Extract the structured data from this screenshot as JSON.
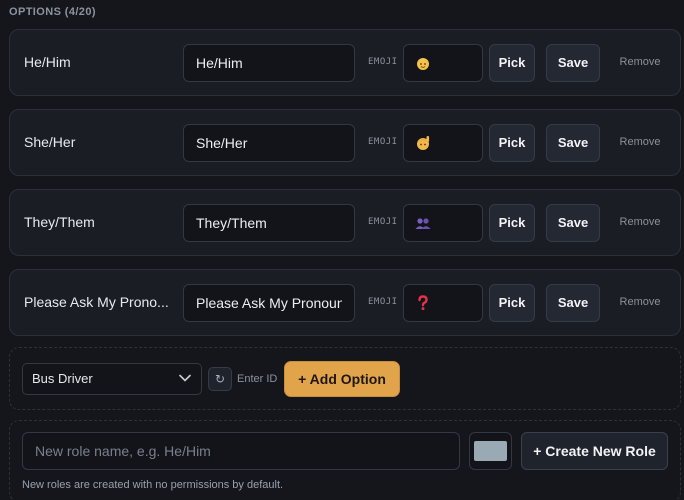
{
  "section": {
    "title": "OPTIONS (4/20)"
  },
  "options": [
    {
      "label": "He/Him",
      "name_value": "He/Him",
      "emoji_tag": "EMOJI",
      "emoji_icon": "person-blond-emoji",
      "pick_label": "Pick",
      "save_label": "Save",
      "remove_label": "Remove"
    },
    {
      "label": "She/Her",
      "name_value": "She/Her",
      "emoji_tag": "EMOJI",
      "emoji_icon": "person-raising-hand-emoji",
      "pick_label": "Pick",
      "save_label": "Save",
      "remove_label": "Remove"
    },
    {
      "label": "They/Them",
      "name_value": "They/Them",
      "emoji_tag": "EMOJI",
      "emoji_icon": "people-silhouette-emoji",
      "pick_label": "Pick",
      "save_label": "Save",
      "remove_label": "Remove"
    },
    {
      "label": "Please Ask My Prono...",
      "name_value": "Please Ask My Pronouns",
      "emoji_tag": "EMOJI",
      "emoji_icon": "red-question-mark-emoji",
      "pick_label": "Pick",
      "save_label": "Save",
      "remove_label": "Remove"
    }
  ],
  "add_option": {
    "select_value": "Bus Driver",
    "refresh_icon": "refresh-icon",
    "enter_id_label": "Enter ID",
    "button_label": "+ Add Option"
  },
  "create_role": {
    "placeholder": "New role name, e.g. He/Him",
    "color_value": "#99aab5",
    "button_label": "+ Create New Role",
    "note": "New roles are created with no permissions by default."
  },
  "colors": {
    "background": "#14161b",
    "card": "#1a1d24",
    "accent": "#e2a44a"
  }
}
